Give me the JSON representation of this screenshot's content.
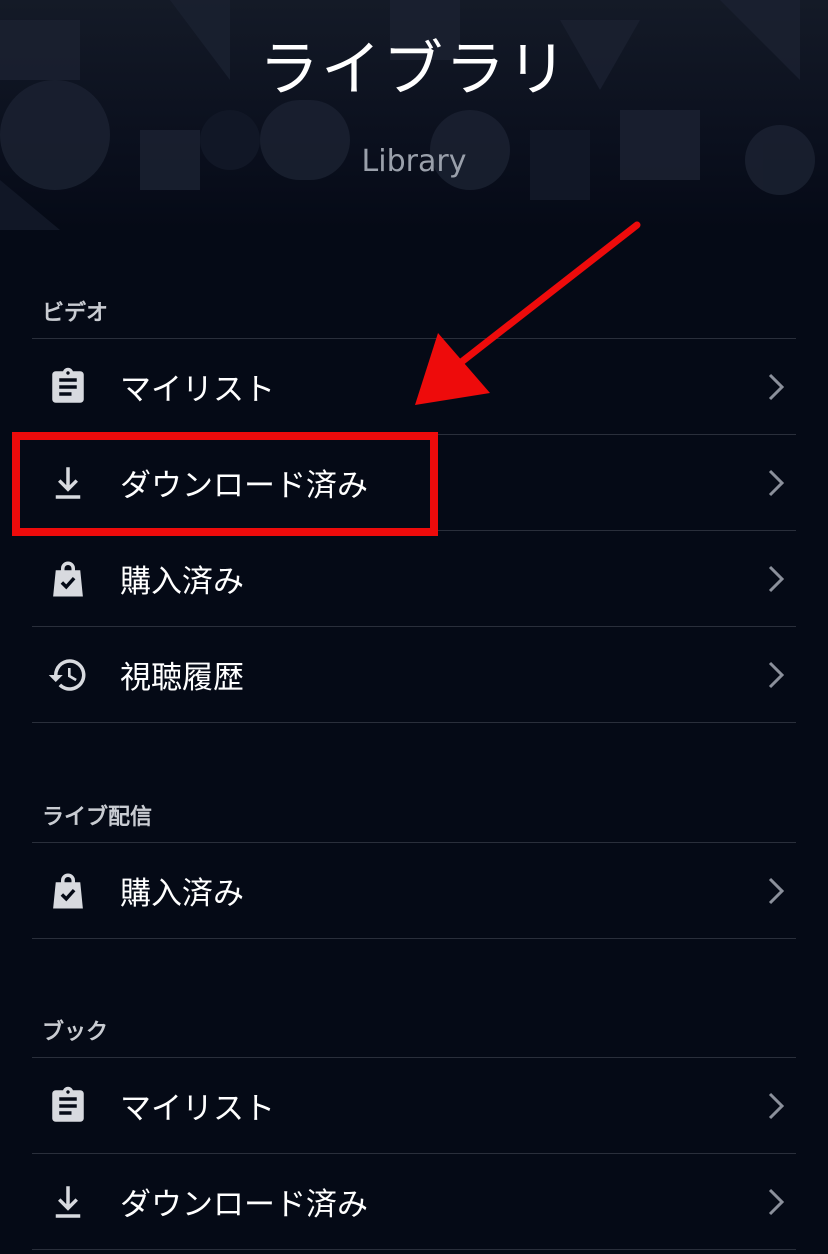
{
  "header": {
    "title": "ライブラリ",
    "subtitle": "Library"
  },
  "sections": [
    {
      "title": "ビデオ",
      "items": [
        {
          "label": "マイリスト",
          "icon": "clipboard-icon"
        },
        {
          "label": "ダウンロード済み",
          "icon": "download-icon"
        },
        {
          "label": "購入済み",
          "icon": "shopping-bag-check-icon"
        },
        {
          "label": "視聴履歴",
          "icon": "history-icon"
        }
      ]
    },
    {
      "title": "ライブ配信",
      "items": [
        {
          "label": "購入済み",
          "icon": "shopping-bag-check-icon"
        }
      ]
    },
    {
      "title": "ブック",
      "items": [
        {
          "label": "マイリスト",
          "icon": "clipboard-icon"
        },
        {
          "label": "ダウンロード済み",
          "icon": "download-icon"
        }
      ]
    }
  ],
  "annotation": {
    "highlight_color": "#ee0b0b",
    "highlighted_item": "ダウンロード済み"
  },
  "colors": {
    "background": "#050a16",
    "divider": "#2a2f3b",
    "text": "#ffffff",
    "section_title": "#c9ccd2",
    "subtitle": "#9aa0ab",
    "icon": "#d8dadf",
    "chevron": "#8b909b"
  }
}
